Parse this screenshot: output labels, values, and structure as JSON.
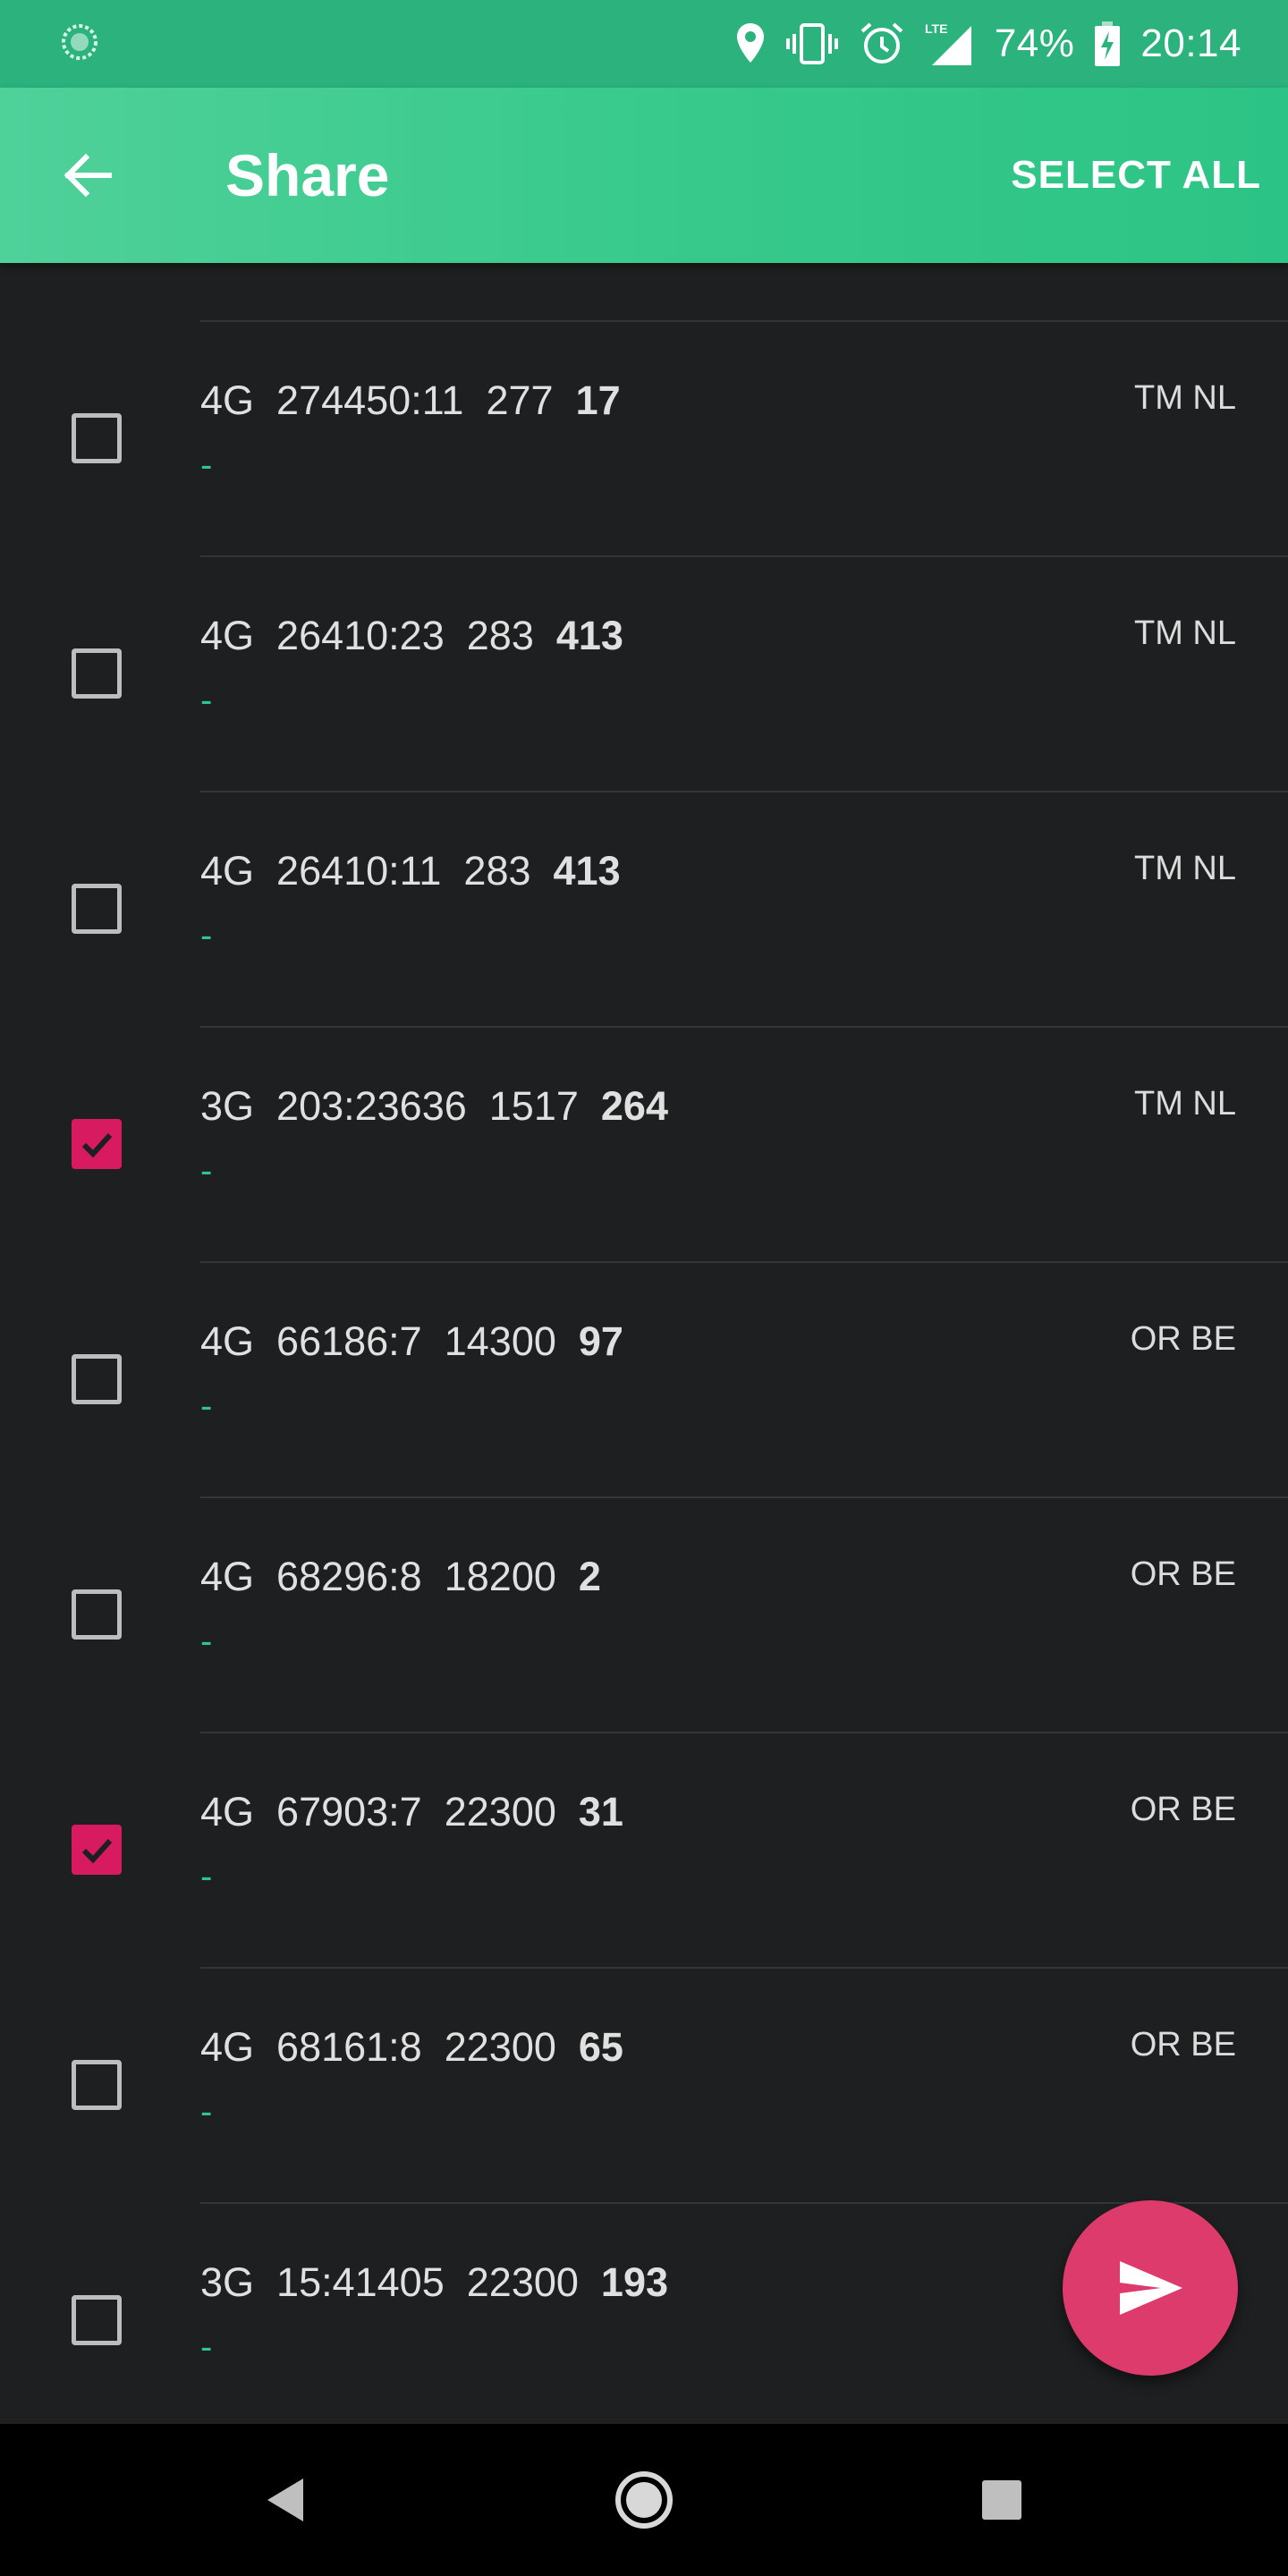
{
  "status_bar": {
    "battery": "74%",
    "time": "20:14",
    "network": "LTE"
  },
  "app_bar": {
    "title": "Share",
    "select_all": "SELECT ALL"
  },
  "rows": [
    {
      "tech": "4G",
      "cell": "274450:11",
      "code": "277",
      "signal": "17",
      "sub": "-",
      "operator": "TM NL",
      "checked": false
    },
    {
      "tech": "4G",
      "cell": "26410:23",
      "code": "283",
      "signal": "413",
      "sub": "-",
      "operator": "TM NL",
      "checked": false
    },
    {
      "tech": "4G",
      "cell": "26410:11",
      "code": "283",
      "signal": "413",
      "sub": "-",
      "operator": "TM NL",
      "checked": false
    },
    {
      "tech": "3G",
      "cell": "203:23636",
      "code": "1517",
      "signal": "264",
      "sub": "-",
      "operator": "TM NL",
      "checked": true
    },
    {
      "tech": "4G",
      "cell": "66186:7",
      "code": "14300",
      "signal": "97",
      "sub": "-",
      "operator": "OR BE",
      "checked": false
    },
    {
      "tech": "4G",
      "cell": "68296:8",
      "code": "18200",
      "signal": "2",
      "sub": "-",
      "operator": "OR BE",
      "checked": false
    },
    {
      "tech": "4G",
      "cell": "67903:7",
      "code": "22300",
      "signal": "31",
      "sub": "-",
      "operator": "OR BE",
      "checked": true
    },
    {
      "tech": "4G",
      "cell": "68161:8",
      "code": "22300",
      "signal": "65",
      "sub": "-",
      "operator": "OR BE",
      "checked": false
    },
    {
      "tech": "3G",
      "cell": "15:41405",
      "code": "22300",
      "signal": "193",
      "sub": "-",
      "operator": "",
      "checked": false
    }
  ],
  "icons": {
    "status_left": "sync-icon",
    "location": "location-pin-icon",
    "vibrate": "vibrate-icon",
    "alarm": "alarm-icon",
    "signal": "cell-signal-icon",
    "battery": "battery-charging-icon",
    "back": "arrow-back-icon",
    "fab": "send-icon",
    "nav_back": "nav-back-icon",
    "nav_home": "nav-home-icon",
    "nav_recents": "nav-recents-icon"
  },
  "colors": {
    "accent": "#d81b60",
    "primary": "#2bb27d",
    "fab": "#dd3b6b",
    "subtext": "#2ec58e"
  }
}
